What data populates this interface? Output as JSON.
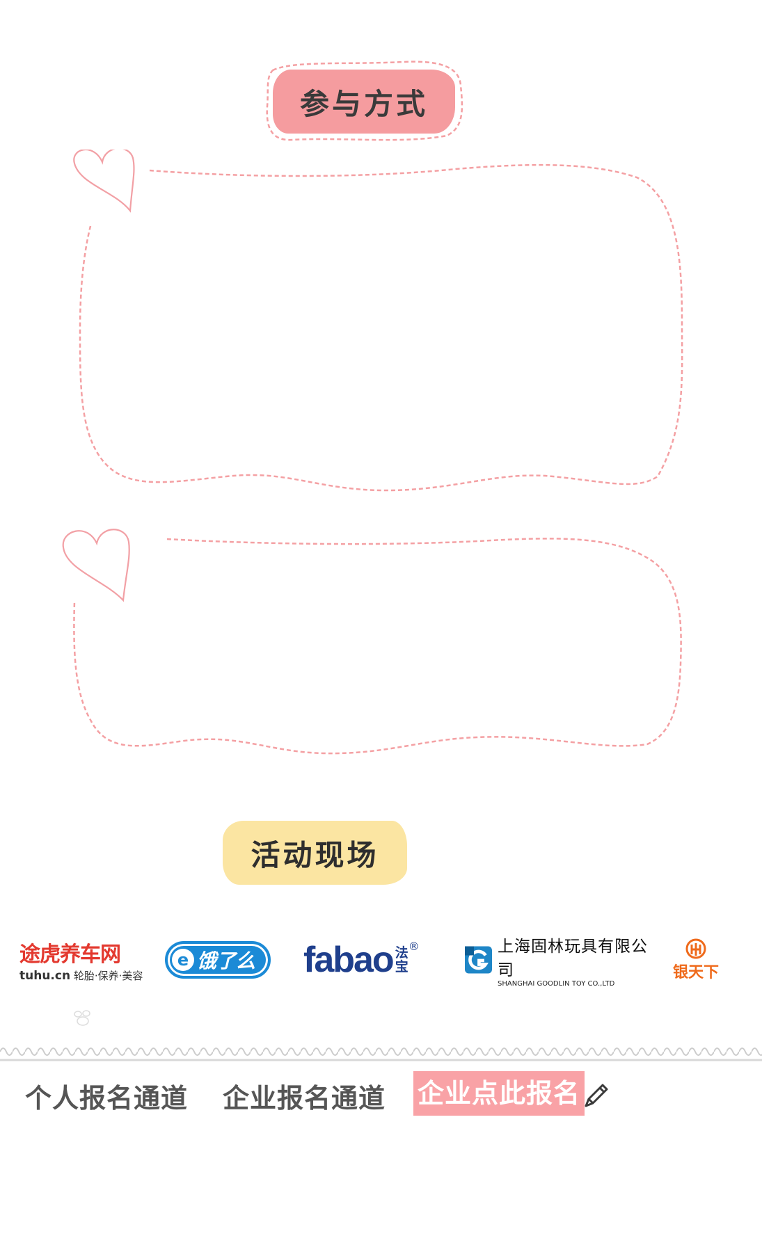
{
  "sections": {
    "participation": {
      "title": "参与方式"
    },
    "live": {
      "title": "活动现场"
    }
  },
  "sponsors": {
    "tuhu": {
      "name_cn": "途虎养车网",
      "domain": "tuhu.cn",
      "tagline": "轮胎·保养·美容"
    },
    "eleme": {
      "name": "饿了么",
      "icon_letter": "e"
    },
    "fabao": {
      "name": "fabao",
      "name_cn_top": "法",
      "name_cn_bottom": "宝",
      "reg": "®"
    },
    "goodlin": {
      "name_cn": "上海固林玩具有限公司",
      "name_en": "SHANGHAI GOODLIN TOY CO.,LTD"
    },
    "yintianxia": {
      "name_cn": "银天下"
    }
  },
  "nav": {
    "personal": "个人报名通道",
    "enterprise": "企业报名通道",
    "register": "企业点此报名"
  },
  "colors": {
    "pink_badge": "#f59c9f",
    "yellow_badge": "#fbe5a2",
    "dashed_pink": "#f4a0a3",
    "register_bg": "#f9a2a6"
  },
  "icons": [
    "heart-icon",
    "paw-icon",
    "pencil-icon"
  ]
}
